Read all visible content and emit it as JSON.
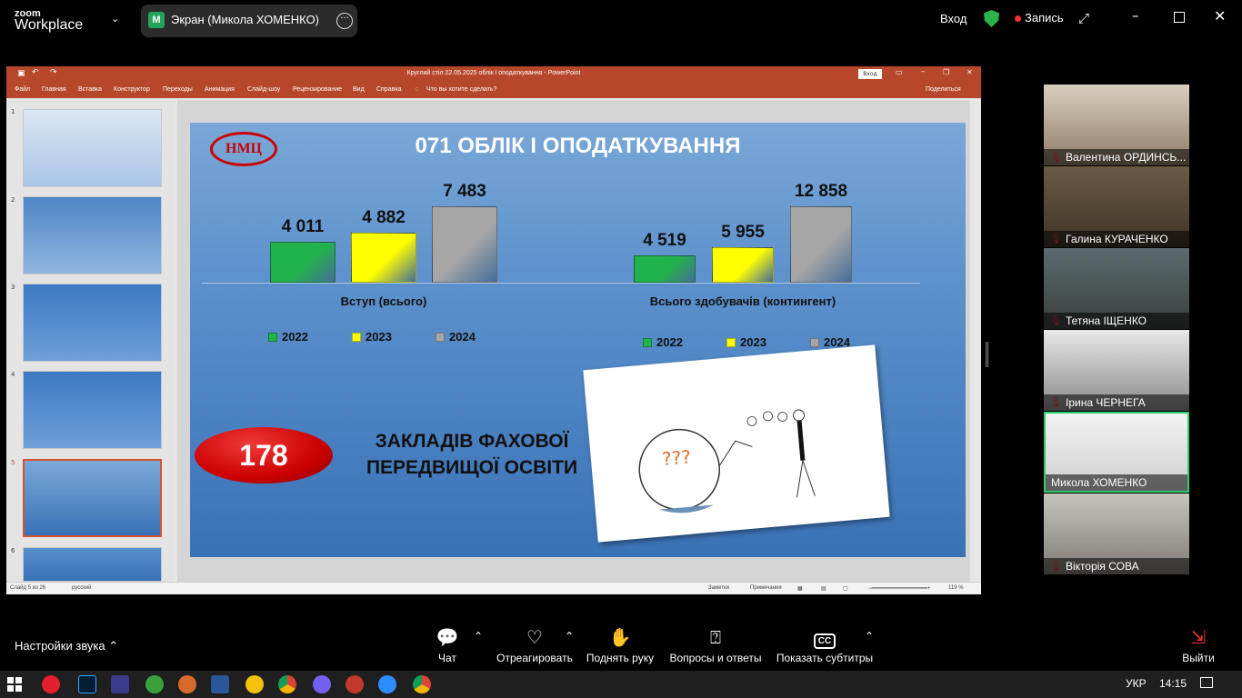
{
  "zoom": {
    "brand_top": "zoom",
    "brand_bottom": "Workplace",
    "screen_avatar": "M",
    "screen_share_label": "Экран (Микола ХОМЕНКО)",
    "login_label": "Вход",
    "record_label": "Запись",
    "participants": [
      {
        "name": "Валентина ОРДИНСЬ..."
      },
      {
        "name": "Галина КУРАЧЕНКО"
      },
      {
        "name": "Тетяна ІЩЕНКО"
      },
      {
        "name": "Ірина ЧЕРНЕГА"
      },
      {
        "name": "Микола ХОМЕНКО"
      },
      {
        "name": "Вікторія СОВА"
      }
    ],
    "toolbar": {
      "audio_settings": "Настройки звука",
      "chat": "Чат",
      "react": "Отреагировать",
      "raise_hand": "Поднять руку",
      "qa": "Вопросы и ответы",
      "captions": "Показать субтитры",
      "leave": "Выйти"
    }
  },
  "powerpoint": {
    "title": "Круглий стіл 22.05.2025 облік і оподаткування  -  PowerPoint",
    "login_btn": "Вход",
    "ribbon_tabs": [
      "Файл",
      "Главная",
      "Вставка",
      "Конструктор",
      "Переходы",
      "Анимация",
      "Слайд-шоу",
      "Рецензирование",
      "Вид",
      "Справка"
    ],
    "tell_me": "Что вы хотите сделать?",
    "share": "Поделиться",
    "thumb_numbers": [
      "1",
      "2",
      "3",
      "4",
      "5",
      "6"
    ],
    "status_slide": "Слайд 5 из 26",
    "status_lang": "русский",
    "status_notes": "Заметки",
    "status_comments": "Примечания",
    "status_zoom": "119 %",
    "slide": {
      "logo": "НМЦ",
      "title": "071 ОБЛІК І ОПОДАТКУВАННЯ",
      "count": "178",
      "institutions": "ЗАКЛАДІВ ФАХОВОЇ ПЕРЕДВИЩОЇ ОСВІТИ"
    }
  },
  "chart_data": [
    {
      "type": "bar",
      "categories": [
        "2022",
        "2023",
        "2024"
      ],
      "values": [
        4011,
        4882,
        7483
      ],
      "value_labels": [
        "4 011",
        "4 882",
        "7 483"
      ],
      "xlabel": "Вступ (всього)",
      "colors": [
        "#22b24c",
        "#ffff00",
        "#a6a6a6"
      ],
      "legend": [
        "2022",
        "2023",
        "2024"
      ]
    },
    {
      "type": "bar",
      "categories": [
        "2022",
        "2023",
        "2024"
      ],
      "values": [
        4519,
        5955,
        12858
      ],
      "value_labels": [
        "4 519",
        "5 955",
        "12 858"
      ],
      "xlabel": "Всього здобувачів (контингент)",
      "colors": [
        "#22b24c",
        "#ffff00",
        "#a6a6a6"
      ],
      "legend": [
        "2022",
        "2023",
        "2024"
      ]
    }
  ],
  "taskbar": {
    "lang": "УКР",
    "time": "14:15"
  }
}
